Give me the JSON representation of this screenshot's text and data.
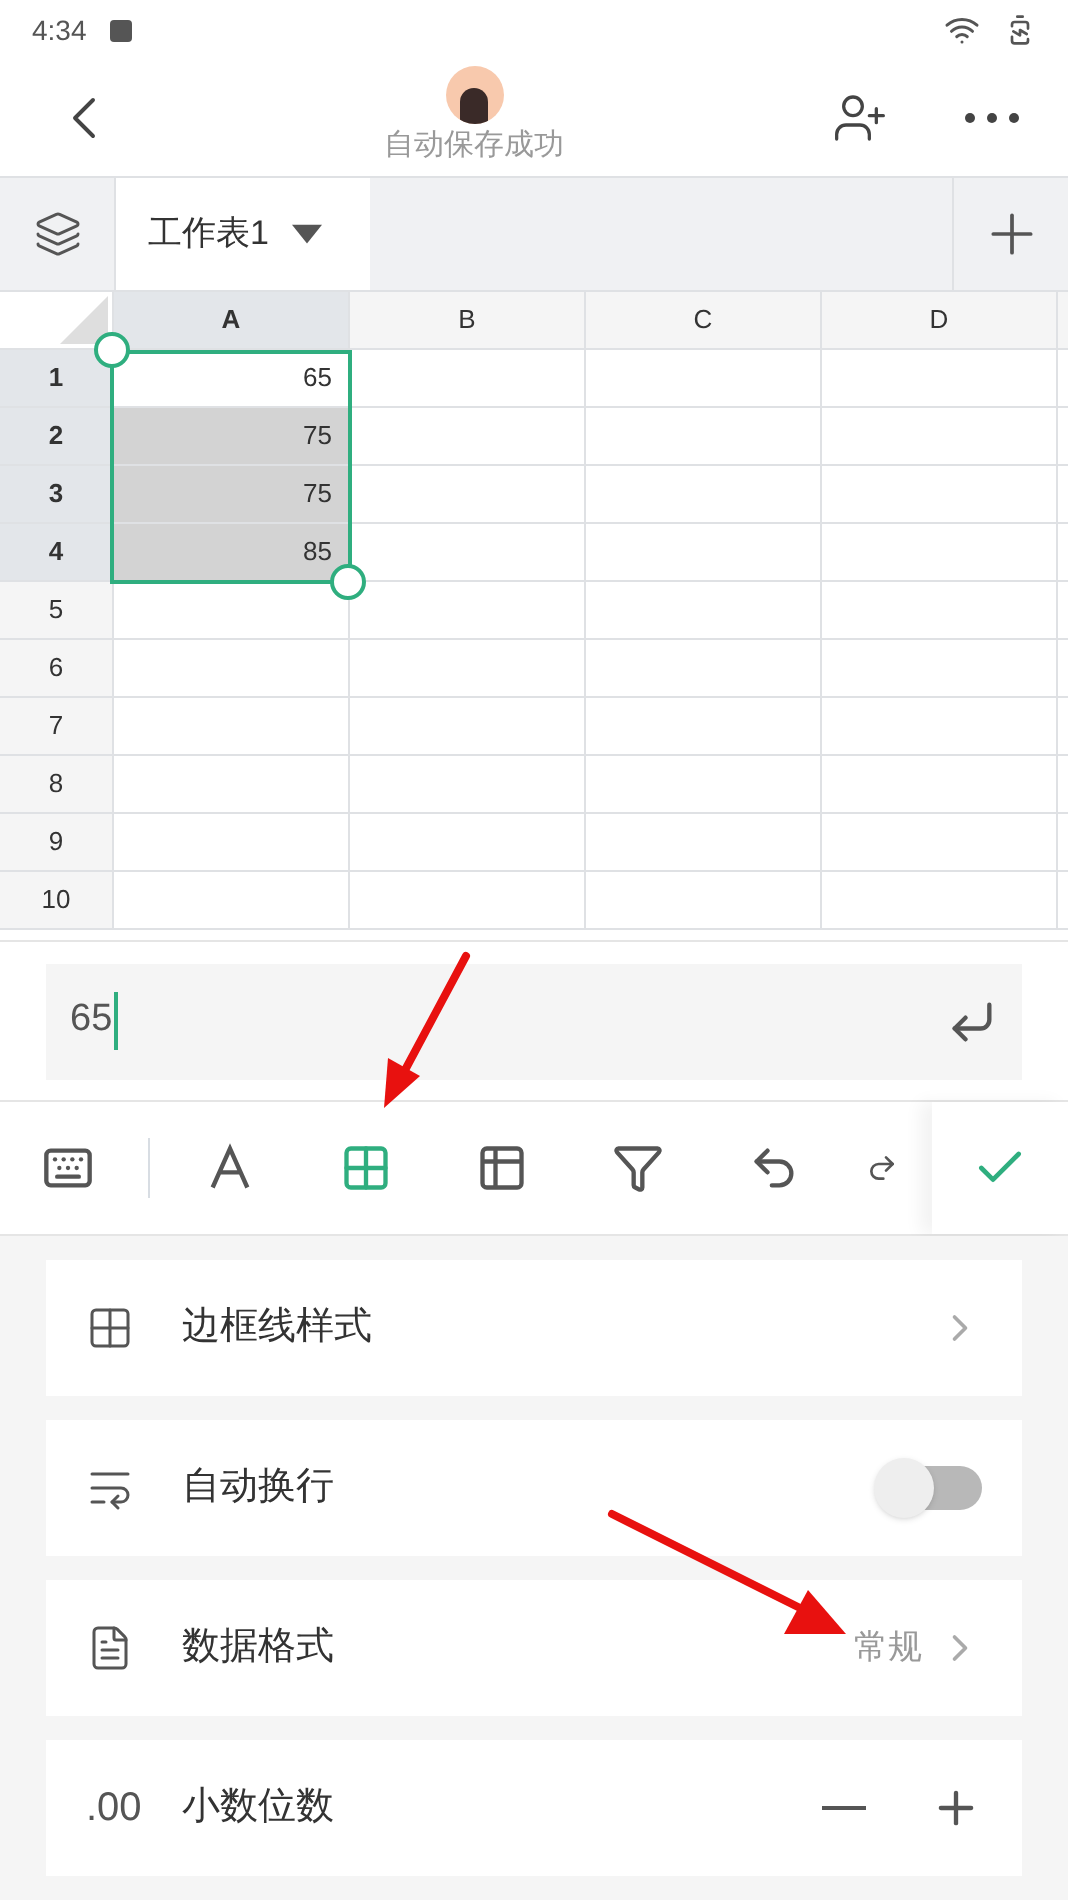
{
  "status_bar": {
    "time": "4:34"
  },
  "header": {
    "subtitle": "自动保存成功"
  },
  "sheet_tabs": [
    {
      "label": "工作表1",
      "selected": true
    }
  ],
  "grid": {
    "columns": [
      {
        "label": "A",
        "selected": true
      },
      {
        "label": "B",
        "selected": false
      },
      {
        "label": "C",
        "selected": false
      },
      {
        "label": "D",
        "selected": false
      }
    ],
    "rows": [
      {
        "label": "1",
        "selected": true,
        "cells": [
          {
            "value": "65",
            "active": true
          }
        ]
      },
      {
        "label": "2",
        "selected": true,
        "cells": [
          {
            "value": "75",
            "active": false
          }
        ]
      },
      {
        "label": "3",
        "selected": true,
        "cells": [
          {
            "value": "75",
            "active": false
          }
        ]
      },
      {
        "label": "4",
        "selected": true,
        "cells": [
          {
            "value": "85",
            "active": false
          }
        ]
      },
      {
        "label": "5",
        "selected": false
      },
      {
        "label": "6",
        "selected": false
      },
      {
        "label": "7",
        "selected": false
      },
      {
        "label": "8",
        "selected": false
      },
      {
        "label": "9",
        "selected": false
      },
      {
        "label": "10",
        "selected": false
      }
    ]
  },
  "formula": {
    "value": "65"
  },
  "toolbar": {
    "tools": [
      {
        "kind": "keyboard",
        "selected": false
      },
      {
        "kind": "font",
        "selected": false
      },
      {
        "kind": "border",
        "selected": true
      },
      {
        "kind": "table",
        "selected": false
      },
      {
        "kind": "filter",
        "selected": false
      },
      {
        "kind": "undo",
        "selected": false
      },
      {
        "kind": "redo",
        "selected": false
      }
    ]
  },
  "settings": [
    {
      "kind": "link",
      "label": "边框线样式"
    },
    {
      "kind": "toggle",
      "label": "自动换行",
      "on": false
    },
    {
      "kind": "link",
      "label": "数据格式",
      "value": "常规"
    },
    {
      "kind": "stepper",
      "label": "小数位数",
      "icon_text": ".00"
    }
  ]
}
